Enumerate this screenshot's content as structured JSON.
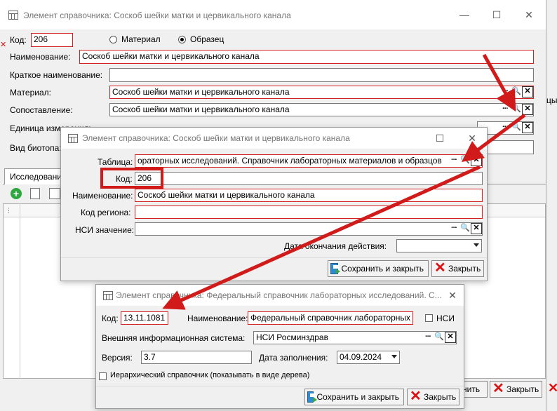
{
  "bg_window": {
    "title": "Элемент справочника: Соскоб шейки матки и цервикального канала",
    "kod_label": "Код:",
    "kod_value": "206",
    "radio_material": "Материал",
    "radio_sample": "Образец",
    "name_label": "Наименование:",
    "name_value": "Соскоб шейки матки и цервикального канала",
    "short_name_label": "Краткое наименование:",
    "short_name_value": "",
    "material_label": "Материал:",
    "material_value": "Соскоб шейки матки и цервикального канала",
    "match_label": "Сопоставление:",
    "match_value": "Соскоб шейки матки и цервикального канала",
    "unit_label": "Единица измерения:",
    "biotope_label": "Вид биотопа:",
    "tab_label": "Исследования",
    "right_cut_text": "цы",
    "close_button": "Закрыть",
    "partial_button": "нить"
  },
  "mid_window": {
    "title": "Элемент справочника: Соскоб шейки матки и цервикального канала",
    "table_label": "Таблица:",
    "table_value": "ораторных исследований. Справочник лабораторных материалов и образцов",
    "kod_label": "Код:",
    "kod_value": "206",
    "name_label": "Наименование:",
    "name_value": "Соскоб шейки матки и цервикального канала",
    "region_label": "Код региона:",
    "region_value": "",
    "nsi_label": "НСИ значение:",
    "nsi_value": "",
    "end_date_label": "Дата окончания действия:",
    "save_button": "Сохранить и закрыть",
    "close_button": "Закрыть"
  },
  "front_window": {
    "title": "Элемент справочника: Федеральный справочник лабораторных исследований. С...",
    "kod_label": "Код:",
    "kod_value": "13.11.1081",
    "name_label": "Наименование:",
    "name_value": "Федеральный справочник лабораторных",
    "nsi_label": "НСИ",
    "ext_system_label": "Внешняя информационная система:",
    "ext_system_value": "НСИ Росминздрав",
    "version_label": "Версия:",
    "version_value": "3.7",
    "fill_date_label": "Дата заполнения:",
    "fill_date_value": "04.09.2024",
    "hierarchy_label": "Иерархический справочник (показывать в виде дерева)",
    "save_button": "Сохранить и закрыть",
    "close_button": "Закрыть"
  },
  "colors": {
    "highlight": "#d11a1a",
    "required_border": "#d42020",
    "title_text": "#777777"
  }
}
